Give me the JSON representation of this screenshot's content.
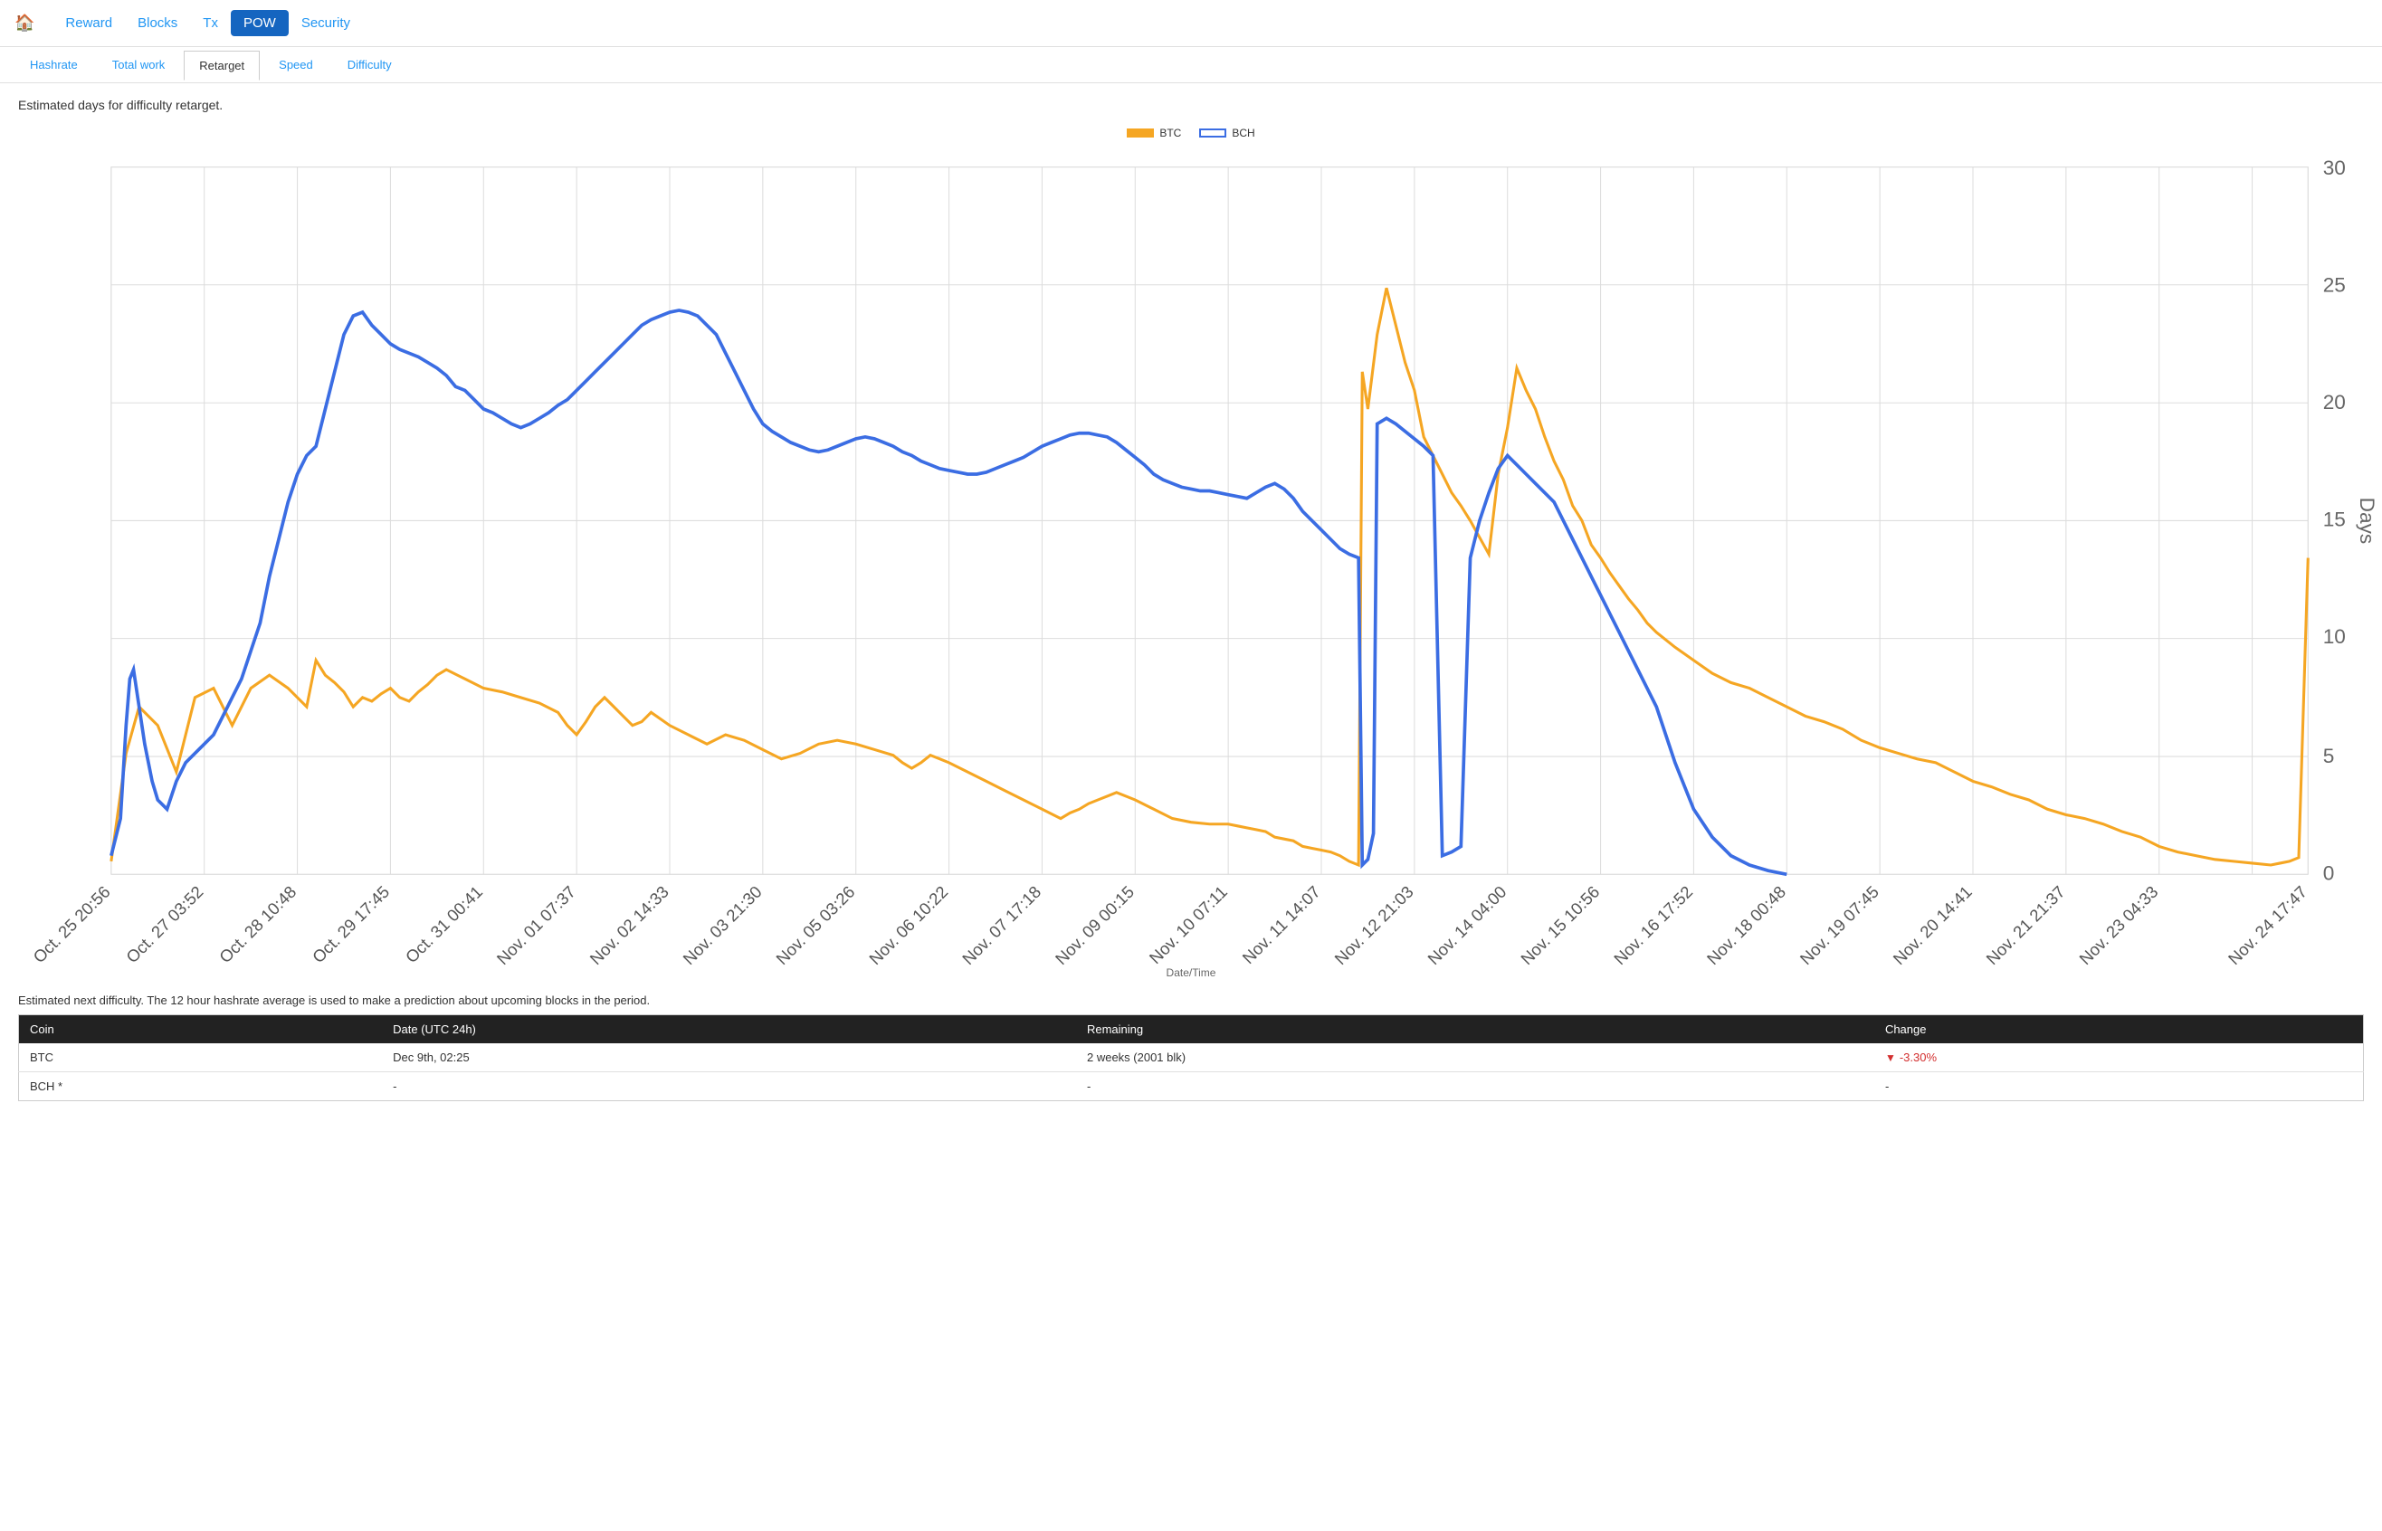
{
  "nav": {
    "home_icon": "🏠",
    "links": [
      {
        "label": "Reward",
        "active": false
      },
      {
        "label": "Blocks",
        "active": false
      },
      {
        "label": "Tx",
        "active": false
      },
      {
        "label": "POW",
        "active": true
      },
      {
        "label": "Security",
        "active": false
      }
    ]
  },
  "tabs": [
    {
      "label": "Hashrate",
      "active": false
    },
    {
      "label": "Total work",
      "active": false
    },
    {
      "label": "Retarget",
      "active": true
    },
    {
      "label": "Speed",
      "active": false
    },
    {
      "label": "Difficulty",
      "active": false
    }
  ],
  "chart": {
    "description": "Estimated days for difficulty retarget.",
    "legend": {
      "btc_label": "BTC",
      "bch_label": "BCH"
    },
    "y_axis_label": "Days",
    "x_axis_label": "Date/Time",
    "y_ticks": [
      "30",
      "25",
      "20",
      "15",
      "10",
      "5",
      "0"
    ],
    "x_labels": [
      "Oct. 25 20:56",
      "Oct. 27 03:52",
      "Oct. 28 10:48",
      "Oct. 29 17:45",
      "Oct. 31 00:41",
      "Nov. 01 07:37",
      "Nov. 02 14:33",
      "Nov. 03 21:30",
      "Nov. 05 03:26",
      "Nov. 06 10:22",
      "Nov. 07 17:18",
      "Nov. 09 00:15",
      "Nov. 10 07:11",
      "Nov. 11 14:07",
      "Nov. 12 21:03",
      "Nov. 14 04:00",
      "Nov. 15 10:56",
      "Nov. 16 17:52",
      "Nov. 18 00:48",
      "Nov. 19 07:45",
      "Nov. 20 14:41",
      "Nov. 21 21:37",
      "Nov. 23 04:33",
      "Nov. 24 17:47"
    ]
  },
  "table": {
    "description": "Estimated next difficulty. The 12 hour hashrate average is used to make a prediction about upcoming blocks in the period.",
    "headers": [
      "Coin",
      "Date (UTC 24h)",
      "Remaining",
      "Change"
    ],
    "rows": [
      {
        "coin": "BTC",
        "date": "Dec 9th, 02:25",
        "remaining": "2 weeks (2001 blk)",
        "change": "-3.30%",
        "change_type": "negative"
      },
      {
        "coin": "BCH *",
        "date": "-",
        "remaining": "-",
        "change": "-",
        "change_type": "neutral"
      }
    ]
  }
}
